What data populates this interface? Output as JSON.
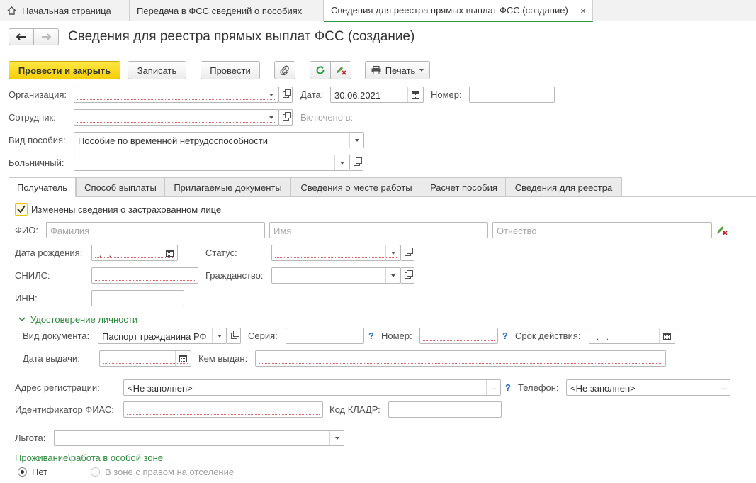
{
  "window_tabs": [
    {
      "label": "Начальная страница"
    },
    {
      "label": "Передача в ФСС сведений о пособиях"
    },
    {
      "label": "Сведения для реестра прямых выплат ФСС (создание)"
    }
  ],
  "page_title": "Сведения для реестра прямых выплат ФСС (создание)",
  "toolbar": {
    "post_close": "Провести и закрыть",
    "save": "Записать",
    "post": "Провести",
    "print": "Печать"
  },
  "header": {
    "org_label": "Организация:",
    "org_value": "",
    "date_label": "Дата:",
    "date_value": "30.06.2021",
    "number_label": "Номер:",
    "number_value": "",
    "employee_label": "Сотрудник:",
    "employee_value": "",
    "included_label": "Включено в:",
    "benefit_label": "Вид пособия:",
    "benefit_value": "Пособие по временной нетрудоспособности",
    "sick_label": "Больничный:",
    "sick_value": ""
  },
  "form_tabs": [
    {
      "label": "Получатель"
    },
    {
      "label": "Способ выплаты"
    },
    {
      "label": "Прилагаемые документы"
    },
    {
      "label": "Сведения о месте работы"
    },
    {
      "label": "Расчет пособия"
    },
    {
      "label": "Сведения для реестра"
    }
  ],
  "recipient": {
    "changed_label": "Изменены сведения о застрахованном лице",
    "changed_checked": true,
    "fio_label": "ФИО:",
    "last_ph": "Фамилия",
    "first_ph": "Имя",
    "middle_ph": "Отчество",
    "birth_label": "Дата рождения:",
    "birth_mask": " .  .",
    "status_label": "Статус:",
    "snils_label": "СНИЛС:",
    "snils_mask": "  -   -",
    "citizenship_label": "Гражданство:",
    "inn_label": "ИНН:"
  },
  "identity": {
    "section_label": "Удостоверение личности",
    "doc_type_label": "Вид документа:",
    "doc_type_value": "Паспорт гражданина РФ",
    "series_label": "Серия:",
    "number_label": "Номер:",
    "validity_label": "Срок действия:",
    "validity_mask": " .  .",
    "issue_date_label": "Дата выдачи:",
    "issue_date_mask": " .  .",
    "issued_by_label": "Кем выдан:",
    "q_mark": "?"
  },
  "address": {
    "reg_label": "Адрес регистрации:",
    "reg_value": "<Не заполнен>",
    "phone_label": "Телефон:",
    "phone_value": "<Не заполнен>",
    "fias_label": "Идентификатор ФИАС:",
    "kladr_label": "Код КЛАДР:",
    "benefit_label": "Льгота:"
  },
  "zone": {
    "title": "Проживание\\работа в особой зоне",
    "opt_no": "Нет",
    "opt_zone": "В зоне с правом на отселение",
    "selected": "Нет"
  },
  "colors": {
    "accent_green": "#2c9a4b",
    "primary_yellow": "#f5cf09",
    "help_blue": "#2169b8"
  }
}
